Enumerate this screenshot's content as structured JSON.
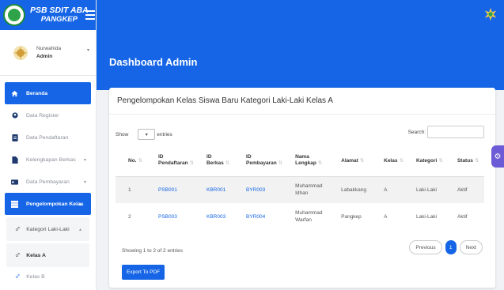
{
  "brand": {
    "line1": "PSB SDIT ABA",
    "line2": "PANGKEP"
  },
  "user": {
    "name": "Nurwahida",
    "role": "Admin"
  },
  "sidebar": {
    "items": [
      {
        "label": "Beranda",
        "icon": "home-icon"
      },
      {
        "label": "Data Register",
        "icon": "register-icon"
      },
      {
        "label": "Data Pendaftaran",
        "icon": "document-icon"
      },
      {
        "label": "Kelengkapan Berkas",
        "icon": "file-icon"
      },
      {
        "label": "Data Pembayaran",
        "icon": "payment-icon"
      },
      {
        "label": "Pengelompokan Kelas",
        "icon": "grid-icon"
      }
    ],
    "sub": [
      {
        "label": "Kategori Laki-Laki"
      },
      {
        "label": "Kelas A"
      },
      {
        "label": "Kelas B"
      }
    ]
  },
  "header": {
    "title": "Dashboard Admin"
  },
  "card": {
    "title": "Pengelompokan Kelas Siswa Baru Kategori Laki-Laki Kelas A",
    "show_label": "Show",
    "entries_label": "entries",
    "search_label": "Search:",
    "columns": [
      "No.",
      "ID Pendaftaran",
      "ID Berkas",
      "ID Pembayaran",
      "Nama Lengkap",
      "Alamat",
      "Kelas",
      "Kategori",
      "Status"
    ],
    "rows": [
      {
        "no": "1",
        "id_pendaftaran": "PSB001",
        "id_berkas": "KBR001",
        "id_pembayaran": "BYR003",
        "nama": "Muhammad Idhan",
        "alamat": "Labakkang",
        "kelas": "A",
        "kategori": "Laki-Laki",
        "status": "Aktif"
      },
      {
        "no": "2",
        "id_pendaftaran": "PSB003",
        "id_berkas": "KBR003",
        "id_pembayaran": "BYR004",
        "nama": "Muhammad Warfan",
        "alamat": "Pangkep",
        "kelas": "A",
        "kategori": "Laki-Laki",
        "status": "Aktif"
      }
    ],
    "info": "Showing 1 to 2 of 2 entries",
    "pagination": {
      "previous": "Previous",
      "page": "1",
      "next": "Next"
    },
    "export_label": "Export To PDF"
  },
  "colors": {
    "primary": "#1565e6",
    "accent": "#6b5bd6"
  }
}
